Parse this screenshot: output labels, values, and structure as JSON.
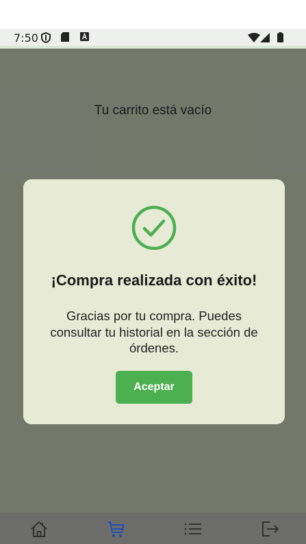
{
  "status_bar": {
    "time": "7:50",
    "icons": [
      "shield-icon",
      "sd-card-icon",
      "keyboard-a-icon",
      "wifi-icon",
      "signal-icon",
      "battery-icon"
    ]
  },
  "cart": {
    "empty_message": "Tu carrito está vacío"
  },
  "dialog": {
    "icon": "check-circle-icon",
    "title": "¡Compra realizada con éxito!",
    "message": "Gracias por tu compra. Puedes consultar tu historial en la sección de órdenes.",
    "accept_label": "Aceptar"
  },
  "bottom_nav": {
    "items": [
      {
        "icon": "home-icon",
        "active": false
      },
      {
        "icon": "cart-icon",
        "active": true
      },
      {
        "icon": "list-icon",
        "active": false
      },
      {
        "icon": "logout-icon",
        "active": false
      }
    ]
  },
  "colors": {
    "accent_green": "#4caf50",
    "active_nav": "#1f4fb5",
    "dialog_bg": "#e7ebd6"
  }
}
